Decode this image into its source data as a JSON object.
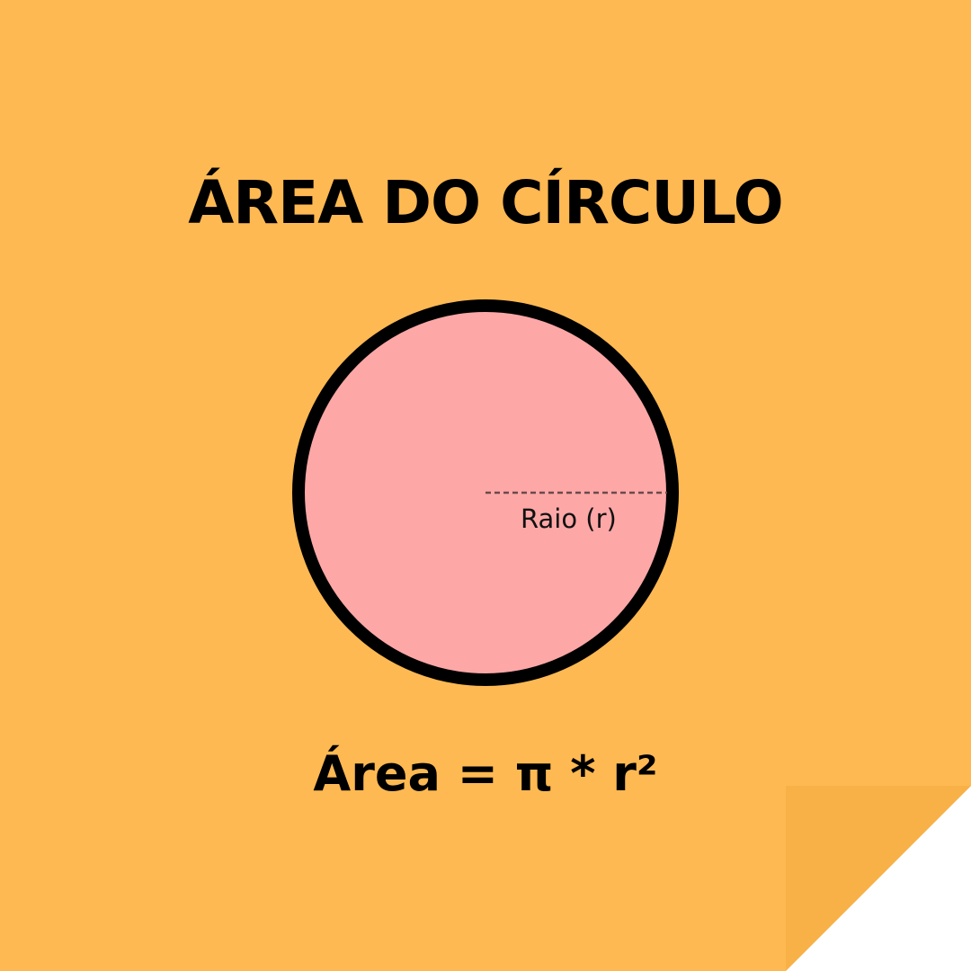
{
  "title": "ÁREA DO CÍRCULO",
  "diagram": {
    "radius_label": "Raio (r)"
  },
  "formula": "Área = π * r²",
  "colors": {
    "background": "#FFB952",
    "circle_fill": "#FEA7A7",
    "circle_stroke": "#000000",
    "page_curl": "#F8B147",
    "radius_line": "#6B4A4A"
  }
}
